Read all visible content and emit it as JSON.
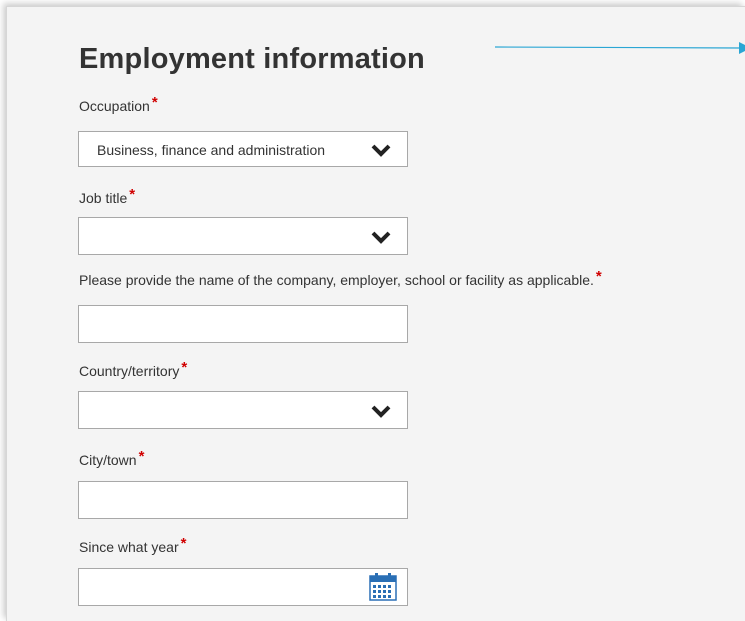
{
  "form": {
    "title": "Employment information",
    "required_marker": "*",
    "occupation": {
      "label": "Occupation",
      "value": "Business, finance and administration"
    },
    "job_title": {
      "label": "Job title",
      "value": ""
    },
    "company": {
      "label": "Please provide the name of the company, employer, school or facility as applicable.",
      "value": ""
    },
    "country": {
      "label": "Country/territory",
      "value": ""
    },
    "city": {
      "label": "City/town",
      "value": ""
    },
    "since_year": {
      "label": "Since what year",
      "value": ""
    }
  },
  "icons": {
    "dropdown": "chevron-down-icon",
    "date_picker": "calendar-icon",
    "annotation": "arrow-right-icon"
  },
  "colors": {
    "required": "#d00000",
    "arrow": "#2aa6d4",
    "calendar": "#2a6fb5",
    "panel": "#f4f4f4"
  }
}
